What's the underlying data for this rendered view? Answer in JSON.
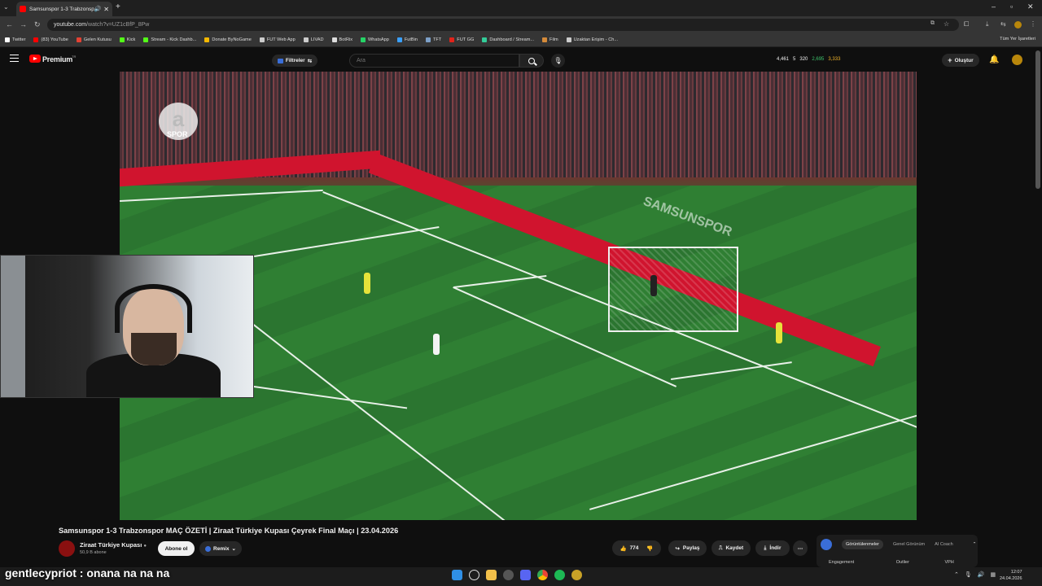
{
  "browser": {
    "tab_title": "Samsunspor 1-3 Trabzonspor",
    "address_host": "youtube.com",
    "address_path": "/watch?v=UZ1cBfP_8Pw",
    "bookmarks": [
      {
        "label": "Twitter",
        "color": "#ffffff"
      },
      {
        "label": "(83) YouTube",
        "color": "#ff0000"
      },
      {
        "label": "Gelen Kutusu",
        "color": "#e34133"
      },
      {
        "label": "Kick",
        "color": "#53fc18"
      },
      {
        "label": "Stream - Kick Dashb...",
        "color": "#53fc18"
      },
      {
        "label": "Donate ByNoGame",
        "color": "#f5b800"
      },
      {
        "label": "FUT Web App",
        "color": "#cccccc"
      },
      {
        "label": "LIVAD",
        "color": "#cccccc"
      },
      {
        "label": "BotRix",
        "color": "#dddddd"
      },
      {
        "label": "WhatsApp",
        "color": "#25d366"
      },
      {
        "label": "FutBin",
        "color": "#3aa0ff"
      },
      {
        "label": "TFT",
        "color": "#7da0c8"
      },
      {
        "label": "FUT GG",
        "color": "#e2231a"
      },
      {
        "label": "Dashboard / Stream...",
        "color": "#33cc99"
      },
      {
        "label": "Film",
        "color": "#d48a3a"
      },
      {
        "label": "Uzaktan Erişim - Ch...",
        "color": "#cccccc"
      }
    ],
    "all_bookmarks": "Tüm Yer İşaretleri"
  },
  "youtube": {
    "logo_text": "Premium",
    "region": "TR",
    "filter_label": "Filtreler",
    "search_placeholder": "Ara",
    "stats": [
      "4,461",
      "5",
      "320",
      "2,695",
      "3,333"
    ],
    "create_label": "Oluştur",
    "video_title": "Samsunspor 1-3 Trabzonspor MAÇ ÖZETİ | Ziraat Türkiye Kupası Çeyrek Final Maçı | 23.04.2026",
    "channel_name": "Ziraat Türkiye Kupası",
    "channel_subs": "50,9 B abone",
    "subscribe_label": "Abone ol",
    "remix_label": "Remix",
    "likes": "774",
    "share_label": "Paylaş",
    "save_label": "Kaydet",
    "download_label": "İndir",
    "side_tabs": [
      "Görüntülenmeler",
      "Genel Görünüm",
      "AI Coach"
    ],
    "side_cols": [
      "Engagement",
      "Outlier",
      "VPH"
    ]
  },
  "broadcast": {
    "logo": "a",
    "logo_sub": "SPOR",
    "board_text": "SAMSUNSPOR"
  },
  "chat": {
    "user": "gentlecypriot",
    "message": "onana na na na"
  },
  "taskbar": {
    "time": "12:07",
    "date": "24.04.2026"
  },
  "colors": {
    "yt_red": "#ff0000",
    "page_bg": "#0f0f0f",
    "chip_bg": "#272727"
  }
}
